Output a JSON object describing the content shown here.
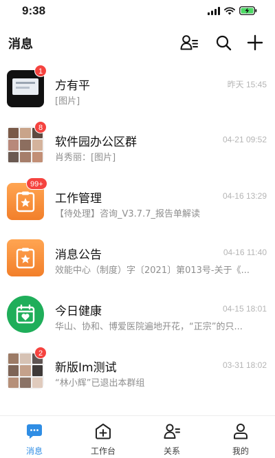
{
  "status_bar": {
    "time": "9:38"
  },
  "header": {
    "title": "消息",
    "icons": [
      "contacts-icon",
      "search-icon",
      "add-icon"
    ]
  },
  "conversations": [
    {
      "name": "方有平",
      "time": "昨天 15:45",
      "preview": "[图片]",
      "badge": "1",
      "avatar": "photo"
    },
    {
      "name": "软件园办公区群",
      "time": "04-21 09:52",
      "preview": "肖秀丽：[图片]",
      "badge": "8",
      "avatar": "group-grid"
    },
    {
      "name": "工作管理",
      "time": "04-16 13:29",
      "preview": "【待处理】咨询_V3.7.7_报告单解读",
      "badge": "99+",
      "avatar": "clipboard-star",
      "accent": "#f5883a"
    },
    {
      "name": "消息公告",
      "time": "04-16 11:40",
      "preview": "效能中心（制度）字〔2021〕第013号-关于《...",
      "badge": "",
      "avatar": "clipboard-star",
      "accent": "#f5883a"
    },
    {
      "name": "今日健康",
      "time": "04-15 18:01",
      "preview": "华山、协和、博爱医院遍地开花，“正宗”的只...",
      "badge": "",
      "avatar": "calendar-heart",
      "accent": "#1fae5a"
    },
    {
      "name": "新版Im测试",
      "time": "03-31 18:02",
      "preview": "“林小辉”已退出本群组",
      "badge": "2",
      "avatar": "group-grid"
    }
  ],
  "tab_bar": {
    "active_color": "#2f8de4",
    "tabs": [
      {
        "label": "消息",
        "icon": "message-icon",
        "active": true
      },
      {
        "label": "工作台",
        "icon": "workbench-icon",
        "active": false
      },
      {
        "label": "关系",
        "icon": "contacts-icon",
        "active": false
      },
      {
        "label": "我的",
        "icon": "profile-icon",
        "active": false
      }
    ]
  }
}
